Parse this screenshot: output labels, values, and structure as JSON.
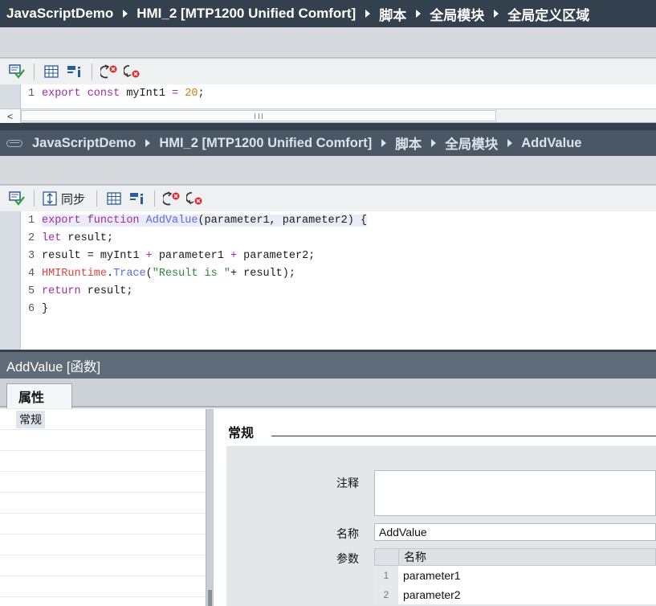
{
  "editor1": {
    "breadcrumb": [
      "JavaScriptDemo",
      "HMI_2 [MTP1200 Unified Comfort]",
      "脚本",
      "全局模块",
      "全局定义区域"
    ],
    "code_lines": [
      {
        "num": "1",
        "tokens": [
          {
            "t": "export const ",
            "c": "kw"
          },
          {
            "t": "myInt1 ",
            "c": "plain"
          },
          {
            "t": "= ",
            "c": "kw"
          },
          {
            "t": "20",
            "c": "num"
          },
          {
            "t": ";",
            "c": "plain"
          }
        ]
      }
    ],
    "scrollbar_left_arrow": "<",
    "icons": [
      "check-in-icon",
      "table-grid-icon",
      "properties-icon",
      "undo-red-icon",
      "redo-red-icon"
    ]
  },
  "editor2": {
    "breadcrumb": [
      "JavaScriptDemo",
      "HMI_2 [MTP1200 Unified Comfort]",
      "脚本",
      "全局模块",
      "AddValue"
    ],
    "sync_label": "同步",
    "code_lines": [
      {
        "num": "1",
        "tokens": [
          {
            "t": "export function ",
            "c": "kw"
          },
          {
            "t": "AddValue",
            "c": "fn"
          },
          {
            "t": "(parameter1, parameter2) {",
            "c": "plain"
          }
        ]
      },
      {
        "num": "2",
        "tokens": [
          {
            "t": "let ",
            "c": "kw"
          },
          {
            "t": "result;",
            "c": "plain"
          }
        ]
      },
      {
        "num": "3",
        "tokens": [
          {
            "t": "result = myInt1 ",
            "c": "plain"
          },
          {
            "t": "+ ",
            "c": "kw"
          },
          {
            "t": "parameter1 ",
            "c": "plain"
          },
          {
            "t": "+ ",
            "c": "kw"
          },
          {
            "t": "parameter2;",
            "c": "plain"
          }
        ]
      },
      {
        "num": "4",
        "tokens": [
          {
            "t": "HMIRuntime",
            "c": "obj"
          },
          {
            "t": ".",
            "c": "plain"
          },
          {
            "t": "Trace",
            "c": "fn"
          },
          {
            "t": "(",
            "c": "plain"
          },
          {
            "t": "\"Result is \"",
            "c": "str"
          },
          {
            "t": "+ result);",
            "c": "plain"
          }
        ]
      },
      {
        "num": "5",
        "tokens": [
          {
            "t": "return ",
            "c": "kw"
          },
          {
            "t": "result;",
            "c": "plain"
          }
        ]
      },
      {
        "num": "6",
        "tokens": [
          {
            "t": "}",
            "c": "plain"
          }
        ]
      }
    ]
  },
  "inspector": {
    "title": "AddValue [函数]",
    "tab_label": "属性",
    "nav_items": [
      "常规"
    ],
    "section_title": "常规",
    "comment_label": "注释",
    "comment_value": "",
    "name_label": "名称",
    "name_value": "AddValue",
    "params_label": "参数",
    "params_header": "名称",
    "params": [
      {
        "index": "1",
        "name": "parameter1"
      },
      {
        "index": "2",
        "name": "parameter2"
      }
    ]
  }
}
